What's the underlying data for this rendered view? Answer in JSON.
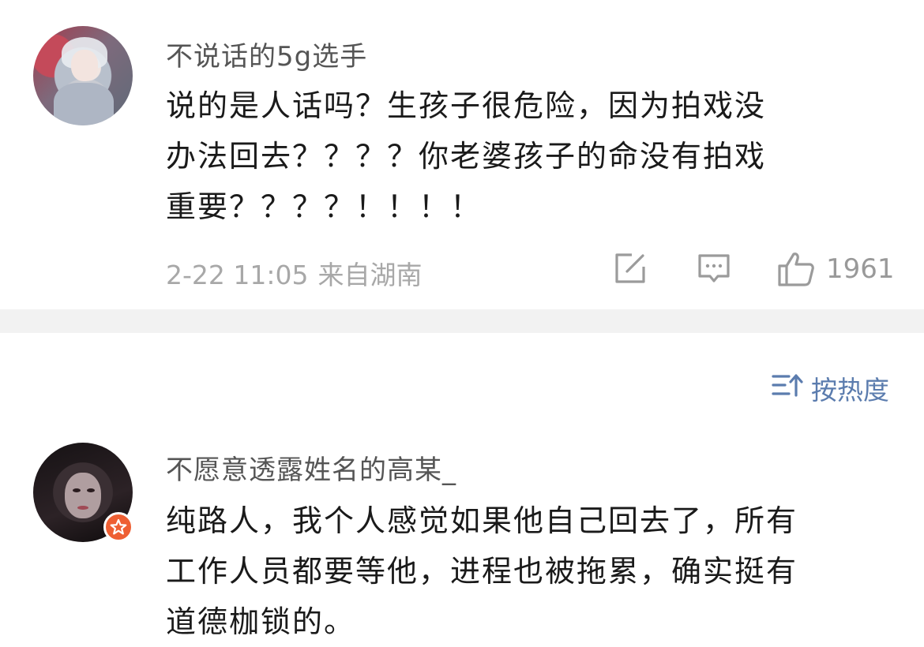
{
  "comments": [
    {
      "username": "不说话的5g选手",
      "lines": [
        "说的是人话吗？生孩子很危险，因为拍戏没",
        "办法回去？？？？你老婆孩子的命没有拍戏",
        "重要？？？？！！！！"
      ],
      "date": "2-22 11:05",
      "location": "来自湖南",
      "likes": "1961"
    },
    {
      "username": "不愿意透露姓名的高某_",
      "lines": [
        "纯路人，我个人感觉如果他自己回去了，所有",
        "工作人员都要等他，进程也被拖累，确实挺有",
        "道德枷锁的。"
      ]
    }
  ],
  "sort": {
    "label": "按热度",
    "icon": "sort-icon"
  },
  "icons": {
    "share": "share-icon",
    "reply": "comment-icon",
    "like": "thumbs-up-icon",
    "badge": "verified-star-icon"
  },
  "colors": {
    "sort_accent": "#5b7cae",
    "badge": "#ee5f33",
    "divider": "#f2f2f2"
  }
}
